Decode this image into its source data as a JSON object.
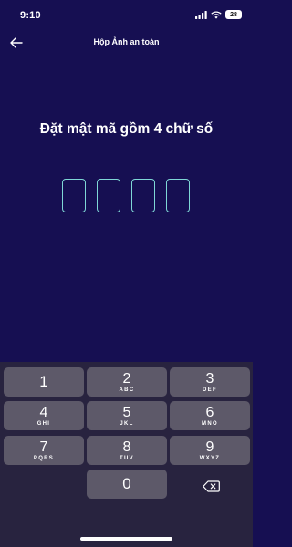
{
  "status": {
    "time": "9:10",
    "battery": "28"
  },
  "nav": {
    "title": "Hộp Ảnh an toàn"
  },
  "main": {
    "heading": "Đặt mật mã gồm 4 chữ số"
  },
  "keypad": {
    "keys": [
      {
        "digit": "1",
        "letters": ""
      },
      {
        "digit": "2",
        "letters": "ABC"
      },
      {
        "digit": "3",
        "letters": "DEF"
      },
      {
        "digit": "4",
        "letters": "GHI"
      },
      {
        "digit": "5",
        "letters": "JKL"
      },
      {
        "digit": "6",
        "letters": "MNO"
      },
      {
        "digit": "7",
        "letters": "PQRS"
      },
      {
        "digit": "8",
        "letters": "TUV"
      },
      {
        "digit": "9",
        "letters": "WXYZ"
      },
      {
        "digit": "0",
        "letters": ""
      }
    ],
    "delete_icon": "backspace-icon"
  }
}
